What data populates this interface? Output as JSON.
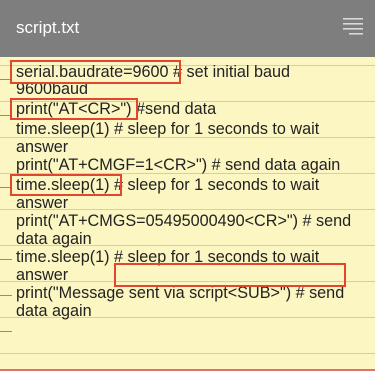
{
  "window": {
    "title": "script.txt",
    "menu_icon": "hamburger-lines-icon"
  },
  "editor": {
    "lines": [
      "serial.baudrate=9600 # set initial baud",
      "9600baud",
      "print(\"AT<CR>\") #send data",
      "time.sleep(1) # sleep for 1 seconds to wait",
      "answer",
      "print(\"AT+CMGF=1<CR>\") # send data again",
      "time.sleep(1) # sleep for 1 seconds to wait",
      "answer",
      "print(\"AT+CMGS=05495000490<CR>\") # send",
      "data again",
      "time.sleep(1) # sleep for 1 seconds to wait",
      "answer",
      "print(\"Message sent via script<SUB>\") # send",
      "data again"
    ]
  },
  "colors": {
    "titlebar": "#7e7e7e",
    "paper": "#fcf6c2",
    "highlight_border": "#e3452f"
  }
}
